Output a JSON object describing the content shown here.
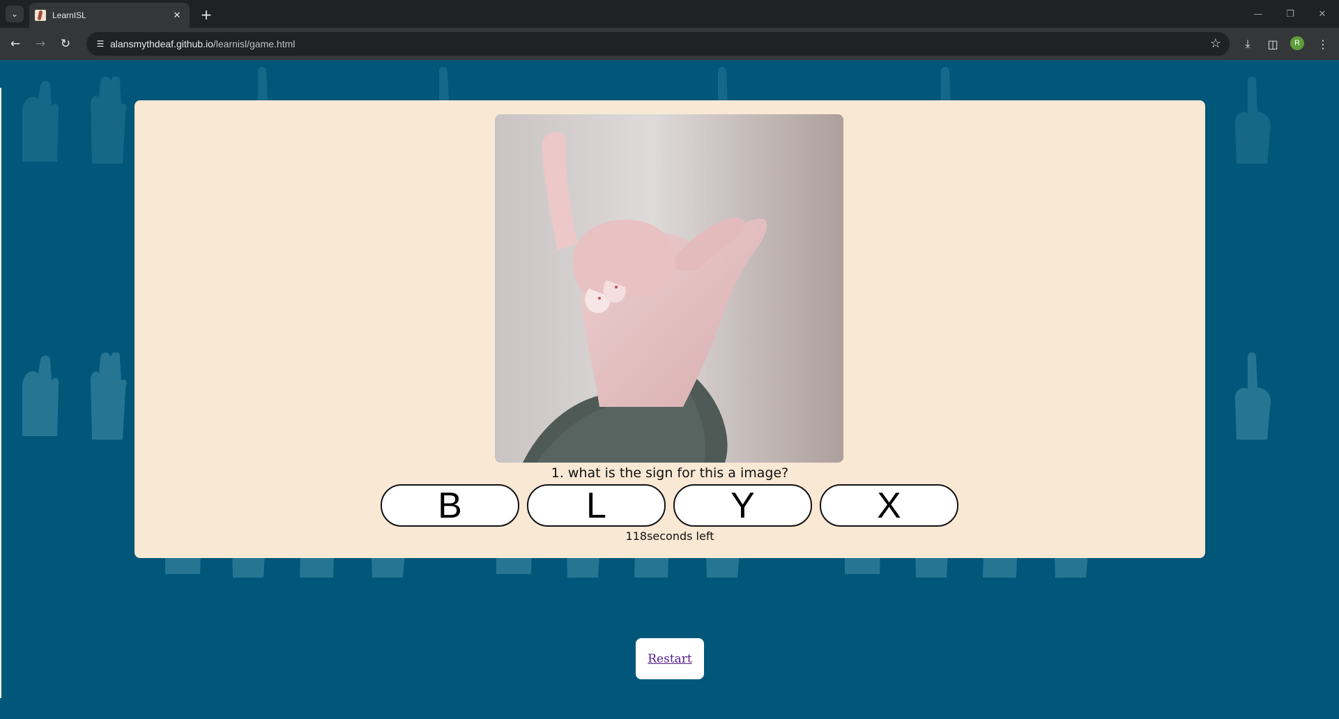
{
  "browser": {
    "tab_title": "LearnISL",
    "url_host": "alansmythdeaf.github.io",
    "url_path": "/learnisl/game.html",
    "profile_initial": "R"
  },
  "game": {
    "question": "1. what is the sign for this a image?",
    "answers": [
      "B",
      "L",
      "Y",
      "X"
    ],
    "timer_text": "118seconds left",
    "restart_label": "Restart"
  },
  "colors": {
    "page_background": "#005779",
    "card_background": "#f9e8d4",
    "link": "#551a8b"
  },
  "icons": {
    "tab_search": "chevron-down-icon",
    "new_tab": "plus-icon",
    "back": "arrow-left-icon",
    "forward": "arrow-right-icon",
    "reload": "reload-icon",
    "site_info": "tune-icon",
    "bookmark": "star-icon",
    "download": "download-icon",
    "side_panel": "side-panel-icon",
    "menu": "more-vert-icon"
  }
}
